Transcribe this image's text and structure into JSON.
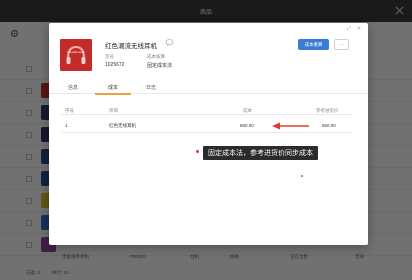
{
  "app": {
    "title": "商品"
  },
  "footer": {
    "selected": "已选: 0",
    "count": "共计: 15"
  },
  "background_row": {
    "name": "无极限参考机",
    "code": "PR0081",
    "c1": "台机",
    "c2": "规格",
    "c3": "正在出售",
    "c4": "无效"
  },
  "product": {
    "title": "红色潮流无线耳机",
    "code_label": "货号",
    "code_value": "1025672",
    "cost_method_label": "成本核算",
    "cost_method_value": "固定成本法"
  },
  "actions": {
    "primary": "成本重算",
    "more": "···"
  },
  "modal_controls": {
    "expand": "⤢",
    "close": "✕"
  },
  "tabs": [
    {
      "label": "信息"
    },
    {
      "label": "成本"
    },
    {
      "label": "日志"
    }
  ],
  "active_tab": 1,
  "cost_table": {
    "headers": {
      "index": "序号",
      "item": "项目",
      "cost": "成本",
      "ref": "参考进货价"
    },
    "rows": [
      {
        "index": "1",
        "item": "红色无线耳机",
        "cost": "860.00",
        "ref": "860.00"
      }
    ]
  },
  "annotation": {
    "text": "固定成本法，参考进货价同步成本",
    "color": "#e03a2c"
  },
  "colors": {
    "primary": "#3a7bd5",
    "tab_accent": "#e8a33d",
    "product_image": "#c42c2c",
    "arrow": "#e03a2c"
  }
}
